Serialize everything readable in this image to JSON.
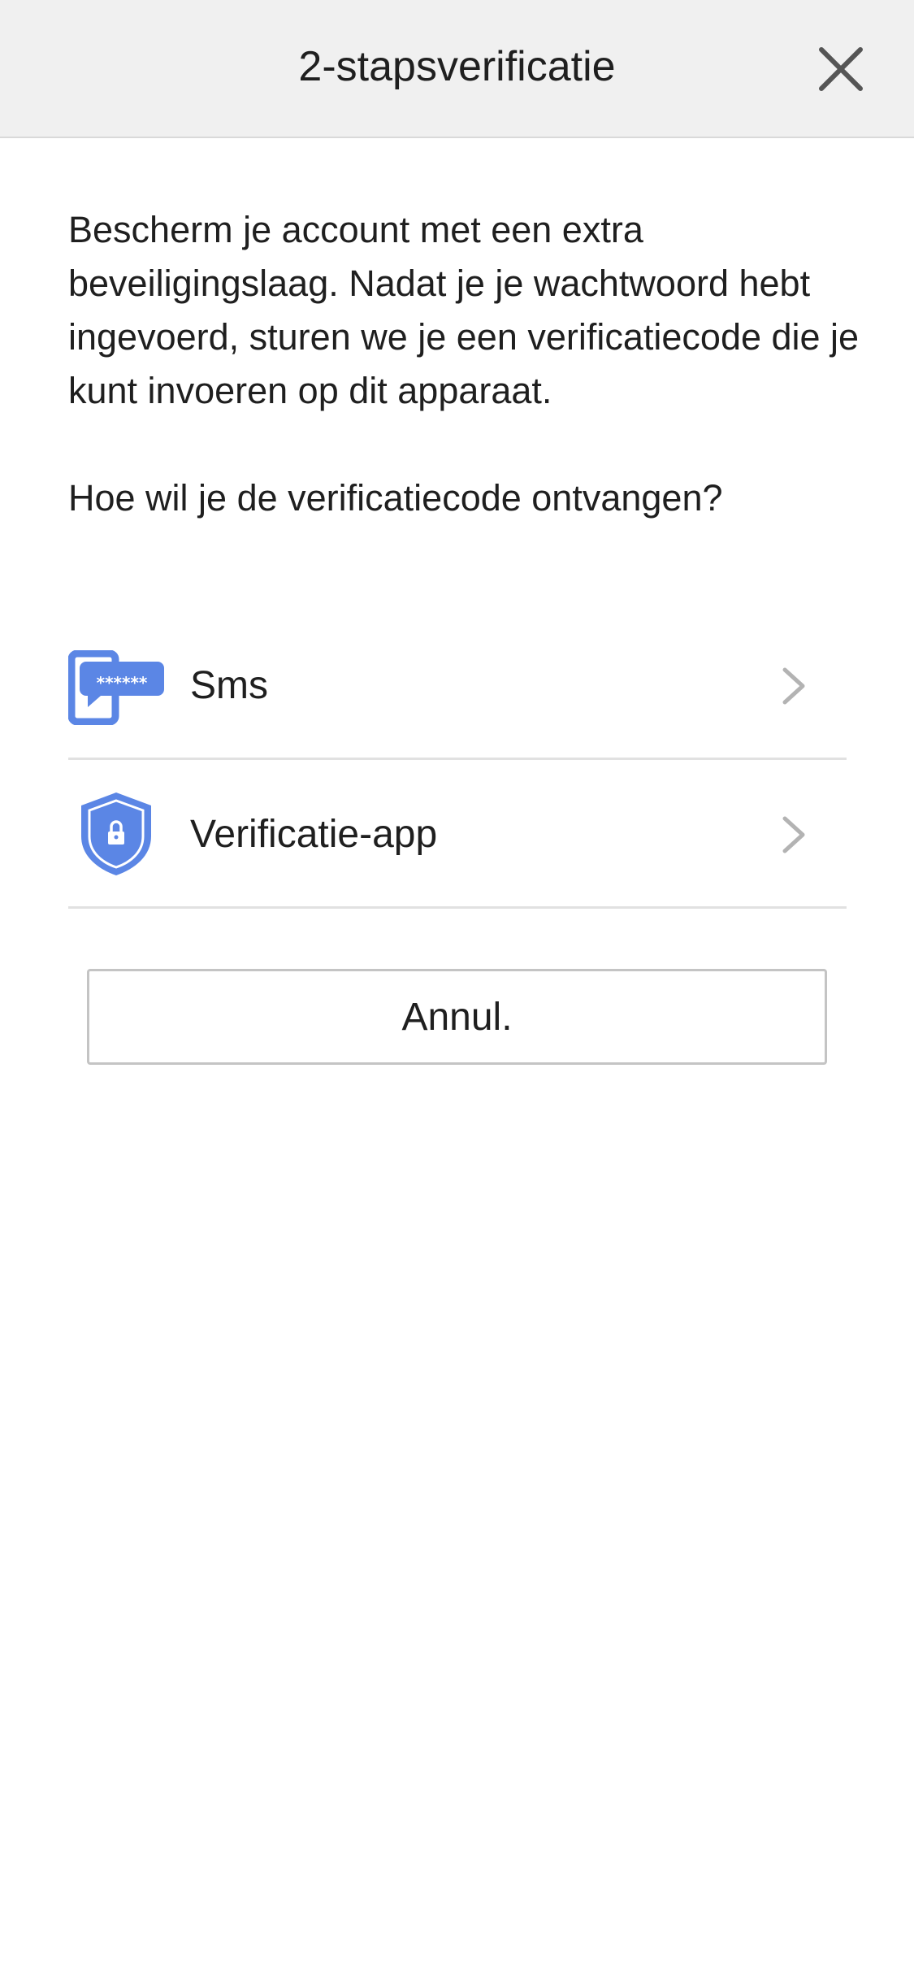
{
  "header": {
    "title": "2-stapsverificatie",
    "close_icon": "close-icon"
  },
  "intro": {
    "description": "Bescherm je account met een extra beveiligingslaag. Nadat je je wachtwoord hebt ingevoerd, sturen we je een verificatiecode die je kunt invoeren op dit apparaat.",
    "question": "Hoe wil je de verificatiecode ontvangen?"
  },
  "options": [
    {
      "label": "Sms",
      "icon": "sms-phone-icon"
    },
    {
      "label": "Verificatie-app",
      "icon": "shield-lock-icon"
    }
  ],
  "sms_icon_text": "******",
  "cancel_label": "Annul.",
  "colors": {
    "accent": "#5b86e5",
    "header_bg": "#f0f0f0",
    "divider": "#e1e1e1",
    "chevron": "#b3b3b3"
  }
}
